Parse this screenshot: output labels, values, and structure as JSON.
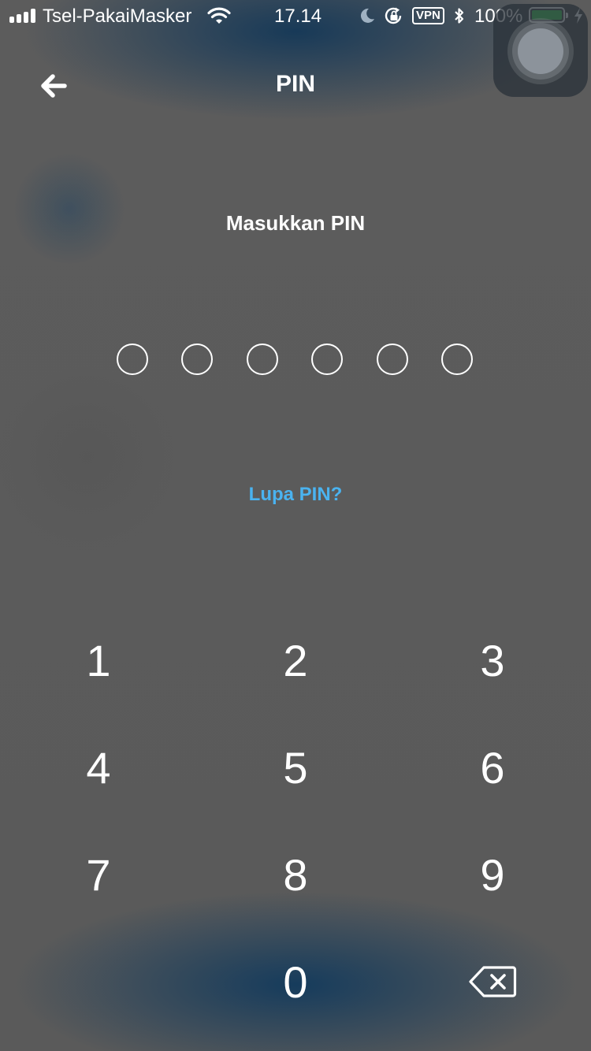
{
  "status_bar": {
    "carrier": "Tsel-PakaiMasker",
    "time": "17.14",
    "vpn_label": "VPN",
    "battery_percent": "100%",
    "battery_level": 1.0,
    "battery_color": "#4cd964",
    "icons": [
      "signal-icon",
      "wifi-icon",
      "moon-icon",
      "rotation-lock-icon",
      "bluetooth-icon",
      "battery-icon",
      "charging-icon"
    ]
  },
  "nav": {
    "title": "PIN",
    "back_icon": "arrow-left-icon"
  },
  "prompt": "Masukkan PIN",
  "pin": {
    "length": 6,
    "entered": 0
  },
  "forgot_link": "Lupa PIN?",
  "keypad": {
    "keys": [
      "1",
      "2",
      "3",
      "4",
      "5",
      "6",
      "7",
      "8",
      "9",
      "0"
    ],
    "delete_icon": "backspace-icon"
  },
  "colors": {
    "link": "#4ab3f0",
    "background": "#5b5b5b",
    "accent_dark": "#143858"
  }
}
